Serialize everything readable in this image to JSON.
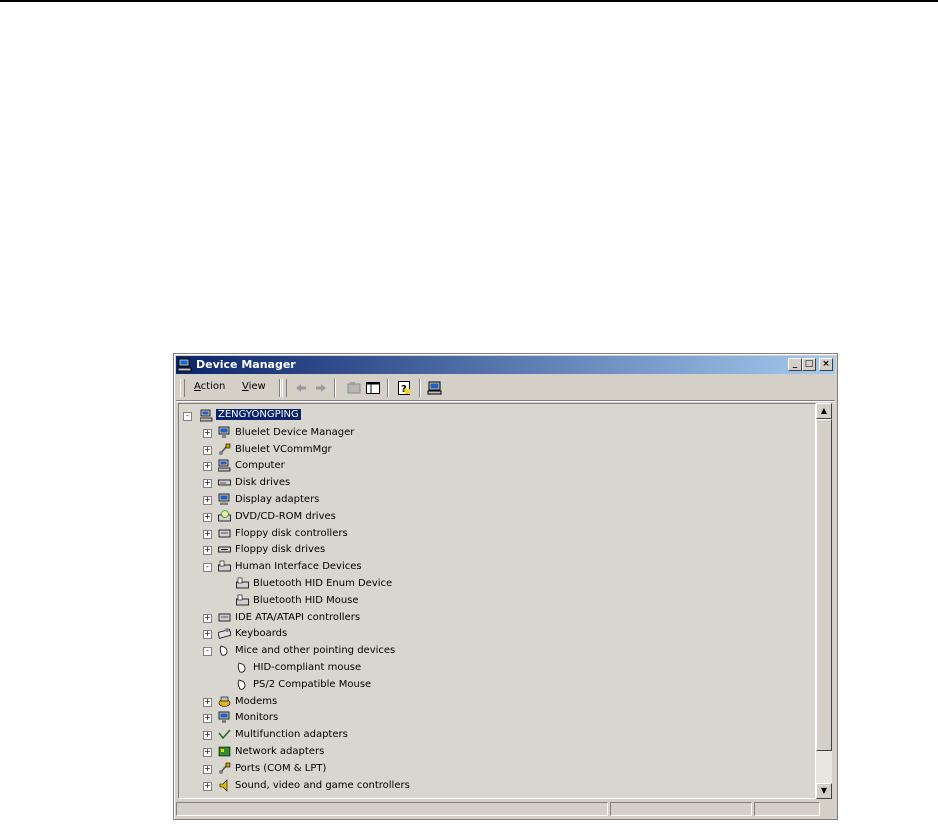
{
  "window": {
    "title": "Device Manager",
    "minimize_glyph": "_",
    "maximize_glyph": "□",
    "close_glyph": "×"
  },
  "menu": {
    "action": {
      "accel": "A",
      "rest": "ction"
    },
    "view": {
      "accel": "V",
      "rest": "iew"
    }
  },
  "toolbar_icons": [
    "back-arrow-icon",
    "forward-arrow-icon",
    "properties-icon",
    "show-hide-tree-icon",
    "help-icon",
    "scan-hardware-icon"
  ],
  "tree": {
    "root": "ZENGYONGPING",
    "nodes": [
      {
        "label": "Bluelet Device Manager",
        "expander": "+",
        "icon": "monitor-icon",
        "depth": 1
      },
      {
        "label": "Bluelet VCommMgr",
        "expander": "+",
        "icon": "port-icon",
        "depth": 1
      },
      {
        "label": "Computer",
        "expander": "+",
        "icon": "computer-icon",
        "depth": 1
      },
      {
        "label": "Disk drives",
        "expander": "+",
        "icon": "disk-drive-icon",
        "depth": 1
      },
      {
        "label": "Display adapters",
        "expander": "+",
        "icon": "display-adapter-icon",
        "depth": 1
      },
      {
        "label": "DVD/CD-ROM drives",
        "expander": "+",
        "icon": "cdrom-icon",
        "depth": 1
      },
      {
        "label": "Floppy disk controllers",
        "expander": "+",
        "icon": "controller-icon",
        "depth": 1
      },
      {
        "label": "Floppy disk drives",
        "expander": "+",
        "icon": "floppy-drive-icon",
        "depth": 1
      },
      {
        "label": "Human Interface Devices",
        "expander": "-",
        "icon": "hid-icon",
        "depth": 1
      },
      {
        "label": "Bluetooth HID Enum Device",
        "expander": "",
        "icon": "hid-icon",
        "depth": 2
      },
      {
        "label": "Bluetooth HID Mouse",
        "expander": "",
        "icon": "hid-icon",
        "depth": 2
      },
      {
        "label": "IDE ATA/ATAPI controllers",
        "expander": "+",
        "icon": "controller-icon",
        "depth": 1
      },
      {
        "label": "Keyboards",
        "expander": "+",
        "icon": "keyboard-icon",
        "depth": 1
      },
      {
        "label": "Mice and other pointing devices",
        "expander": "-",
        "icon": "mouse-icon",
        "depth": 1
      },
      {
        "label": "HID-compliant mouse",
        "expander": "",
        "icon": "mouse-icon",
        "depth": 2
      },
      {
        "label": "PS/2 Compatible Mouse",
        "expander": "",
        "icon": "mouse-icon",
        "depth": 2
      },
      {
        "label": "Modems",
        "expander": "+",
        "icon": "modem-icon",
        "depth": 1
      },
      {
        "label": "Monitors",
        "expander": "+",
        "icon": "monitor-icon",
        "depth": 1
      },
      {
        "label": "Multifunction adapters",
        "expander": "+",
        "icon": "multifunction-icon",
        "depth": 1
      },
      {
        "label": "Network adapters",
        "expander": "+",
        "icon": "network-adapter-icon",
        "depth": 1
      },
      {
        "label": "Ports (COM & LPT)",
        "expander": "+",
        "icon": "port-icon",
        "depth": 1
      },
      {
        "label": "Sound, video and game controllers",
        "expander": "+",
        "icon": "sound-icon",
        "depth": 1
      }
    ]
  },
  "colors": {
    "title_gradient_start": "#0a246a",
    "title_gradient_end": "#a6caf0",
    "selection": "#0a246a",
    "face": "#d4d0c8"
  }
}
